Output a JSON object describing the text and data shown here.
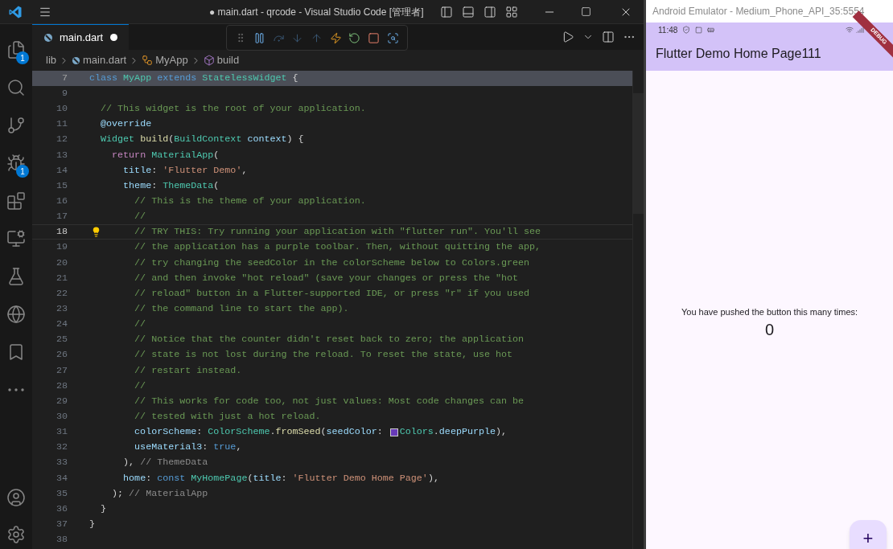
{
  "title_bar": {
    "title": "● main.dart - qrcode - Visual Studio Code [管理者]"
  },
  "activity_bar": {
    "items": [
      {
        "badge": "1",
        "selected": false
      },
      {
        "selected": false
      },
      {
        "selected": false
      },
      {
        "badge": "1",
        "selected": false
      },
      {
        "selected": false
      },
      {
        "selected": false
      },
      {
        "selected": false
      },
      {
        "selected": false
      },
      {
        "selected": false
      },
      {
        "selected": false
      }
    ]
  },
  "tab": {
    "label": "main.dart",
    "modified": true,
    "selected": true
  },
  "breadcrumbs": [
    "lib",
    "main.dart",
    "MyApp",
    "build"
  ],
  "editor": {
    "sticky_line": {
      "number": "7",
      "tokens": [
        {
          "kind": "kw",
          "text": "class"
        },
        {
          "kind": "type",
          "text": " MyApp"
        },
        {
          "kind": "kw",
          "text": " extends"
        },
        {
          "kind": "type",
          "text": " StatelessWidget"
        },
        {
          "kind": "plain",
          "text": " {"
        }
      ]
    },
    "lines": [
      {
        "number": "9",
        "current": false
      },
      {
        "number": "10",
        "current": false,
        "tokens": [
          {
            "kind": "comment",
            "text": "  // This widget is the root of your application."
          }
        ]
      },
      {
        "number": "11",
        "current": false,
        "tokens": [
          {
            "kind": "prop",
            "text": "  @override"
          }
        ]
      },
      {
        "number": "12",
        "current": false,
        "tokens": [
          {
            "kind": "type",
            "text": "  Widget"
          },
          {
            "kind": "fn",
            "text": " build"
          },
          {
            "kind": "plain",
            "text": "("
          },
          {
            "kind": "type",
            "text": "BuildContext"
          },
          {
            "kind": "prop",
            "text": " context"
          },
          {
            "kind": "plain",
            "text": ") {"
          }
        ]
      },
      {
        "number": "13",
        "current": false,
        "tokens": [
          {
            "kind": "control",
            "text": "    return"
          },
          {
            "kind": "type",
            "text": " MaterialApp"
          },
          {
            "kind": "plain",
            "text": "("
          }
        ]
      },
      {
        "number": "14",
        "current": false,
        "tokens": [
          {
            "kind": "prop",
            "text": "      title"
          },
          {
            "kind": "plain",
            "text": ": "
          },
          {
            "kind": "str",
            "text": "'Flutter Demo'"
          },
          {
            "kind": "plain",
            "text": ","
          }
        ]
      },
      {
        "number": "15",
        "current": false,
        "tokens": [
          {
            "kind": "prop",
            "text": "      theme"
          },
          {
            "kind": "plain",
            "text": ": "
          },
          {
            "kind": "type",
            "text": "ThemeData"
          },
          {
            "kind": "plain",
            "text": "("
          }
        ]
      },
      {
        "number": "16",
        "current": false,
        "tokens": [
          {
            "kind": "comment",
            "text": "        // This is the theme of your application."
          }
        ]
      },
      {
        "number": "17",
        "current": false,
        "tokens": [
          {
            "kind": "comment",
            "text": "        //"
          }
        ]
      },
      {
        "number": "18",
        "current": true,
        "tokens": [
          {
            "kind": "comment",
            "text": "        // TRY THIS: Try running your application with \"flutter run\". You'll see"
          }
        ]
      },
      {
        "number": "19",
        "current": false,
        "tokens": [
          {
            "kind": "comment",
            "text": "        // the application has a purple toolbar. Then, without quitting the app,"
          }
        ]
      },
      {
        "number": "20",
        "current": false,
        "tokens": [
          {
            "kind": "comment",
            "text": "        // try changing the seedColor in the colorScheme below to Colors.green"
          }
        ]
      },
      {
        "number": "21",
        "current": false,
        "tokens": [
          {
            "kind": "comment",
            "text": "        // and then invoke \"hot reload\" (save your changes or press the \"hot"
          }
        ]
      },
      {
        "number": "22",
        "current": false,
        "tokens": [
          {
            "kind": "comment",
            "text": "        // reload\" button in a Flutter-supported IDE, or press \"r\" if you used"
          }
        ]
      },
      {
        "number": "23",
        "current": false,
        "tokens": [
          {
            "kind": "comment",
            "text": "        // the command line to start the app)."
          }
        ]
      },
      {
        "number": "24",
        "current": false,
        "tokens": [
          {
            "kind": "comment",
            "text": "        //"
          }
        ]
      },
      {
        "number": "25",
        "current": false,
        "tokens": [
          {
            "kind": "comment",
            "text": "        // Notice that the counter didn't reset back to zero; the application"
          }
        ]
      },
      {
        "number": "26",
        "current": false,
        "tokens": [
          {
            "kind": "comment",
            "text": "        // state is not lost during the reload. To reset the state, use hot"
          }
        ]
      },
      {
        "number": "27",
        "current": false,
        "tokens": [
          {
            "kind": "comment",
            "text": "        // restart instead."
          }
        ]
      },
      {
        "number": "28",
        "current": false,
        "tokens": [
          {
            "kind": "comment",
            "text": "        //"
          }
        ]
      },
      {
        "number": "29",
        "current": false,
        "tokens": [
          {
            "kind": "comment",
            "text": "        // This works for code too, not just values: Most code changes can be"
          }
        ]
      },
      {
        "number": "30",
        "current": false,
        "tokens": [
          {
            "kind": "comment",
            "text": "        // tested with just a hot reload."
          }
        ]
      },
      {
        "number": "31",
        "current": false,
        "tokens": [
          {
            "kind": "prop",
            "text": "        colorScheme"
          },
          {
            "kind": "plain",
            "text": ": "
          },
          {
            "kind": "type",
            "text": "ColorScheme"
          },
          {
            "kind": "plain",
            "text": "."
          },
          {
            "kind": "fn",
            "text": "fromSeed"
          },
          {
            "kind": "plain",
            "text": "("
          },
          {
            "kind": "prop",
            "text": "seedColor"
          },
          {
            "kind": "plain",
            "text": ": "
          },
          {
            "kind": "swatch",
            "color": "#673ab7"
          },
          {
            "kind": "type",
            "text": "Colors"
          },
          {
            "kind": "plain",
            "text": "."
          },
          {
            "kind": "prop",
            "text": "deepPurple"
          },
          {
            "kind": "plain",
            "text": "),"
          }
        ]
      },
      {
        "number": "32",
        "current": false,
        "tokens": [
          {
            "kind": "prop",
            "text": "        useMaterial3"
          },
          {
            "kind": "plain",
            "text": ": "
          },
          {
            "kind": "kw",
            "text": "true"
          },
          {
            "kind": "plain",
            "text": ","
          }
        ]
      },
      {
        "number": "33",
        "current": false,
        "tokens": [
          {
            "kind": "plain",
            "text": "      ), "
          },
          {
            "kind": "hint",
            "text": "// ThemeData"
          }
        ]
      },
      {
        "number": "34",
        "current": false,
        "tokens": [
          {
            "kind": "prop",
            "text": "      home"
          },
          {
            "kind": "plain",
            "text": ": "
          },
          {
            "kind": "kw",
            "text": "const"
          },
          {
            "kind": "type",
            "text": " MyHomePage"
          },
          {
            "kind": "plain",
            "text": "("
          },
          {
            "kind": "prop",
            "text": "title"
          },
          {
            "kind": "plain",
            "text": ": "
          },
          {
            "kind": "str",
            "text": "'Flutter Demo Home Page'"
          },
          {
            "kind": "plain",
            "text": "),"
          }
        ]
      },
      {
        "number": "35",
        "current": false,
        "tokens": [
          {
            "kind": "plain",
            "text": "    ); "
          },
          {
            "kind": "hint",
            "text": "// MaterialApp"
          }
        ]
      },
      {
        "number": "36",
        "current": false,
        "tokens": [
          {
            "kind": "plain",
            "text": "  }"
          }
        ]
      },
      {
        "number": "37",
        "current": false,
        "tokens": [
          {
            "kind": "plain",
            "text": "}"
          }
        ]
      },
      {
        "number": "38",
        "current": false
      }
    ]
  },
  "emulator": {
    "window_title": "Android Emulator - Medium_Phone_API_35:5554",
    "time": "11:48",
    "debug_banner": "DEBUG",
    "app_title": "Flutter Demo Home Page111",
    "message": "You have pushed the button this many times:",
    "counter": "0",
    "fab": "+"
  }
}
